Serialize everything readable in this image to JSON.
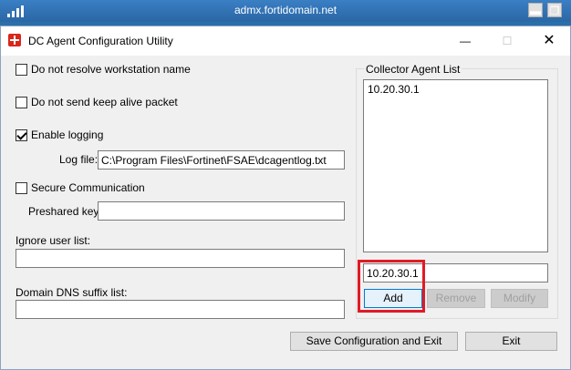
{
  "remote": {
    "host": "admx.fortidomain.net",
    "minimize_icon": "minimize-icon",
    "restore_icon": "restore-icon",
    "signal_icon": "signal-icon"
  },
  "window": {
    "title": "DC Agent Configuration Utility",
    "close_glyph": "✕",
    "max_glyph": "☐",
    "min_glyph": "—"
  },
  "options": {
    "no_resolve_label": "Do not resolve workstation name",
    "no_keepalive_label": "Do not send keep alive packet",
    "enable_logging_label": "Enable logging",
    "log_file_label": "Log file:",
    "log_file_value": "C:\\Program Files\\Fortinet\\FSAE\\dcagentlog.txt",
    "secure_comm_label": "Secure Communication",
    "preshared_label": "Preshared key:",
    "preshared_value": "",
    "ignore_label": "Ignore user list:",
    "ignore_value": "",
    "dns_label": "Domain DNS suffix list:",
    "dns_value": ""
  },
  "collector": {
    "title": "Collector Agent List",
    "items": [
      "10.20.30.1"
    ],
    "input_value": "10.20.30.1",
    "add_label": "Add",
    "remove_label": "Remove",
    "modify_label": "Modify"
  },
  "footer": {
    "save_label": "Save Configuration and Exit",
    "exit_label": "Exit"
  },
  "colors": {
    "highlight": "#e01b24",
    "session_bar": "#2a67a5"
  }
}
